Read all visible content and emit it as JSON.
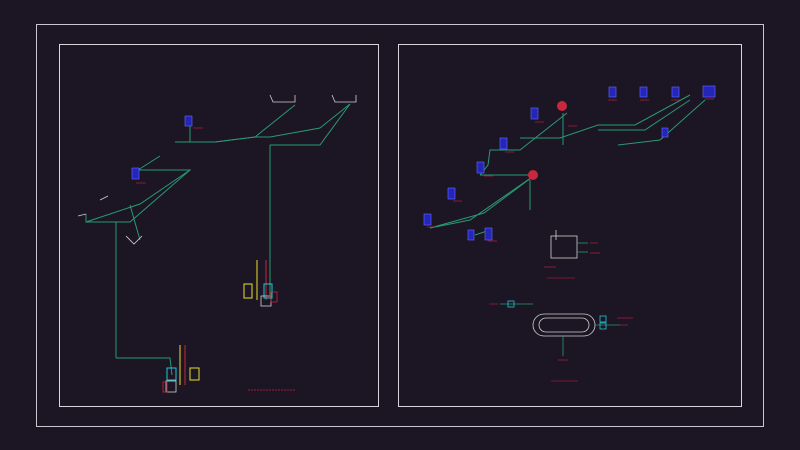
{
  "canvas": {
    "background": "#1b1524"
  },
  "colors": {
    "frame": "#c9c6cf",
    "sheet": "#d8d6dc",
    "pipe": "#2a9a72",
    "pipe_light": "#6fb8a0",
    "line_white": "#d0d0d0",
    "fixture": "#2326b8",
    "fixture_outline": "#6a6cff",
    "label_red": "#d21e3c",
    "valve_cyan": "#22c8d8",
    "valve_yellow": "#e8e02a",
    "pump_red": "#c8283c"
  },
  "drawing": {
    "left_sheet_caption": "",
    "right_sheet_caption": ""
  }
}
